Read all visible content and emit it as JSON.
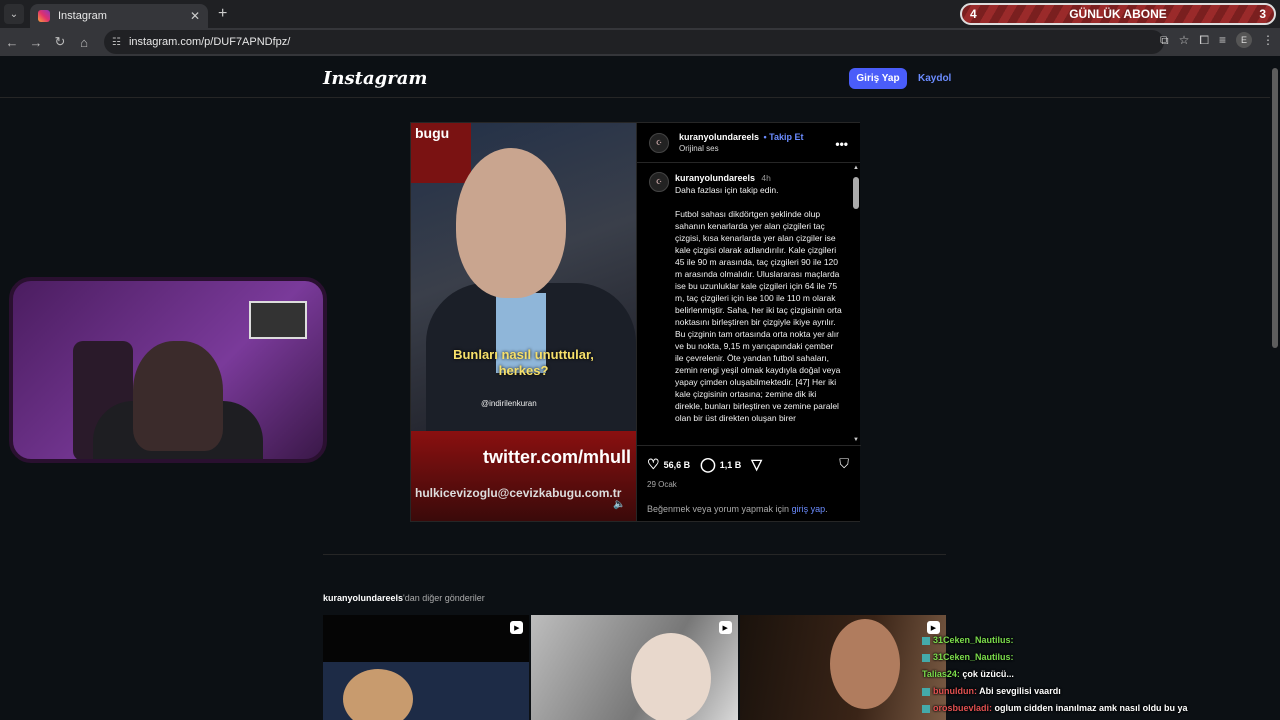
{
  "browser": {
    "tab_title": "Instagram",
    "tab_close": "✕",
    "new_tab": "+",
    "url": "instagram.com/p/DUF7APNDfpz/",
    "profile_letter": "E"
  },
  "overlay_banner": {
    "left_num": "4",
    "label": "GÜNLÜK ABONE",
    "right_num": "3"
  },
  "header": {
    "logo": "Instagram",
    "login_label": "Giriş Yap",
    "signup_label": "Kaydol"
  },
  "post": {
    "username": "kuranyolundareels",
    "follow_label": "Takip Et",
    "audio": "Orijinal ses",
    "more": "•••",
    "caption_username": "kuranyolundareels",
    "caption_time": "4h",
    "caption_lead": "Daha fazlası için takip edin.",
    "caption_body": "Futbol sahası dikdörtgen şeklinde olup sahanın kenarlarda yer alan çizgileri taç çizgisi, kısa kenarlarda yer alan çizgiler ise kale çizgisi olarak adlandırılır. Kale çizgileri 45 ile 90 m arasında, taç çizgileri 90 ile 120 m arasında olmalıdır. Uluslararası maçlarda ise bu uzunluklar kale çizgileri için 64 ile 75 m, taç çizgileri için ise 100 ile 110 m olarak belirlenmiştir. Saha, her iki taç çizgisinin orta noktasını birleştiren bir çizgiyle ikiye ayrılır. Bu çizginin tam ortasında orta nokta yer alır ve bu nokta, 9,15 m yarıçapındaki çember ile çevrelenir. Öte yandan futbol sahaları, zemin rengi yeşil olmak kaydıyla doğal veya yapay çimden oluşabilmektedir. [47] Her iki kale çizgisinin ortasına; zemine dik iki direkle, bunları birleştiren ve zemine paralel olan bir üst direkten oluşan birer",
    "likes": "56,6 B",
    "comments": "1,1 B",
    "date": "29 Ocak",
    "login_note_prefix": "Beğenmek veya yorum yapmak için ",
    "login_note_link": "giriş yap",
    "login_note_suffix": "."
  },
  "video": {
    "channel_tag": "bugu",
    "subtitle": "Bunları nasıl unuttular, herkes?",
    "watermark": "@indirilenkuran",
    "banner_url": "twitter.com/mhull",
    "banner_mail": "hulkicevizoglu@cevizkabugu.com.tr"
  },
  "more_posts": {
    "username": "kuranyolundareels",
    "suffix": "'dan diğer gönderiler"
  },
  "chat": [
    {
      "user": "31Ceken_Nautilus:",
      "msg": ""
    },
    {
      "user": "31Ceken_Nautilus:",
      "msg": ""
    },
    {
      "user": "Talias24:",
      "msg": "çok üzücü..."
    },
    {
      "user": "bunuldun:",
      "msg": "Abi sevgilisi vaardı"
    },
    {
      "user": "orosbuevladi:",
      "msg": "oglum cidden inanılmaz amk nasıl oldu bu ya"
    }
  ],
  "colors": {
    "accent": "#4a5df9",
    "link": "#6b8cff",
    "background": "#0c1014"
  }
}
